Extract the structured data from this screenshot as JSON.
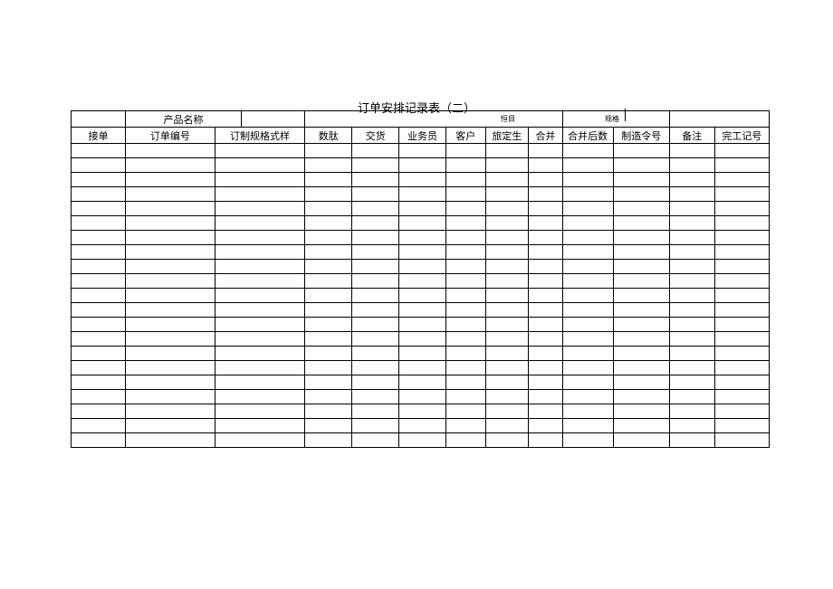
{
  "title": "订单安排记录表（二）",
  "top_labels": {
    "product_name": "产品名称",
    "hm": "恒目",
    "hg": "规格"
  },
  "columns": {
    "c1": "接单",
    "c2": "订单编号",
    "c3": "订制规格式样",
    "c4": "数肽",
    "c5": "交货",
    "c6": "业务员",
    "c7": "客户",
    "c8": "旅定生",
    "c9": "合并",
    "c10": "合并后数",
    "c11": "制造令号",
    "c12": "备注",
    "c13": "完工记号"
  },
  "body_rows": 21
}
